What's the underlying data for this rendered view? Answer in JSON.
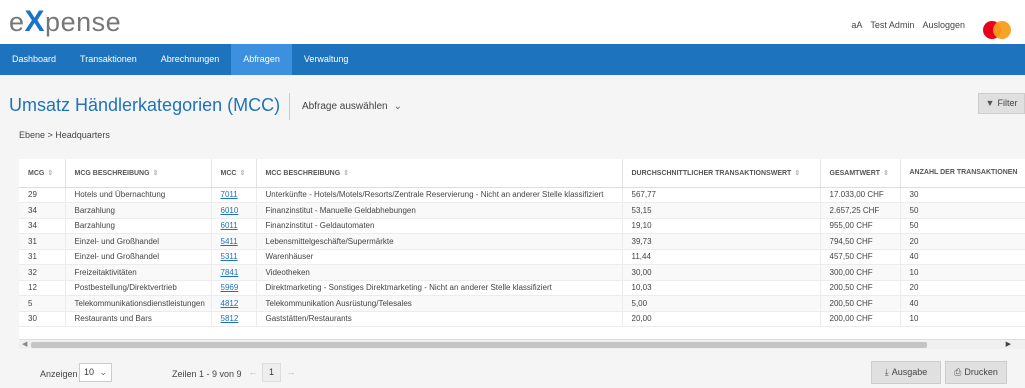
{
  "brand": {
    "logo_prefix": "e",
    "logo_x": "X",
    "logo_suffix": "pense"
  },
  "header": {
    "font_size_toggle": "aA",
    "user_name": "Test Admin",
    "logout": "Ausloggen"
  },
  "nav": {
    "items": [
      "Dashboard",
      "Transaktionen",
      "Abrechnungen",
      "Abfragen",
      "Verwaltung"
    ],
    "active": "Abfragen"
  },
  "page": {
    "title": "Umsatz Händlerkategorien (MCC)",
    "query_select": "Abfrage auswählen",
    "filter_label": "Filter",
    "breadcrumb": "Ebene > Headquarters"
  },
  "table": {
    "columns": [
      "MCG",
      "MCG BESCHREIBUNG",
      "MCC",
      "MCC BESCHREIBUNG",
      "DURCHSCHNITTLICHER TRANSAKTIONSWERT",
      "GESAMTWERT",
      "ANZAHL DER TRANSAKTIONEN"
    ],
    "rows": [
      [
        "29",
        "Hotels und Übernachtung",
        "7011",
        "Unterkünfte - Hotels/Motels/Resorts/Zentrale Reservierung - Nicht an anderer Stelle klassifiziert",
        "567,77",
        "17.033,00 CHF",
        "30"
      ],
      [
        "34",
        "Barzahlung",
        "6010",
        "Finanzinstitut - Manuelle Geldabhebungen",
        "53,15",
        "2.657,25 CHF",
        "50"
      ],
      [
        "34",
        "Barzahlung",
        "6011",
        "Finanzinstitut - Geldautomaten",
        "19,10",
        "955,00 CHF",
        "50"
      ],
      [
        "31",
        "Einzel- und Großhandel",
        "5411",
        "Lebensmittelgeschäfte/Supermärkte",
        "39,73",
        "794,50 CHF",
        "20"
      ],
      [
        "31",
        "Einzel- und Großhandel",
        "5311",
        "Warenhäuser",
        "11,44",
        "457,50 CHF",
        "40"
      ],
      [
        "32",
        "Freizeitaktivitäten",
        "7841",
        "Videotheken",
        "30,00",
        "300,00 CHF",
        "10"
      ],
      [
        "12",
        "Postbestellung/Direktvertrieb",
        "5969",
        "Direktmarketing - Sonstiges Direktmarketing - Nicht an anderer Stelle klassifiziert",
        "10,03",
        "200,50 CHF",
        "20"
      ],
      [
        "5",
        "Telekommunikationsdienstleistungen",
        "4812",
        "Telekommunikation Ausrüstung/Telesales",
        "5,00",
        "200,50 CHF",
        "40"
      ],
      [
        "30",
        "Restaurants und Bars",
        "5812",
        "Gaststätten/Restaurants",
        "20,00",
        "200,00 CHF",
        "10"
      ]
    ]
  },
  "footer": {
    "show_label": "Anzeigen",
    "page_size": "10",
    "rows_info": "Zeilen 1 - 9 von 9",
    "current_page": "1",
    "prev": "←",
    "next": "→",
    "export_label": "Ausgabe",
    "print_label": "Drucken"
  },
  "colors": {
    "accent": "#1e73be",
    "nav_active": "#3d8fe0"
  }
}
